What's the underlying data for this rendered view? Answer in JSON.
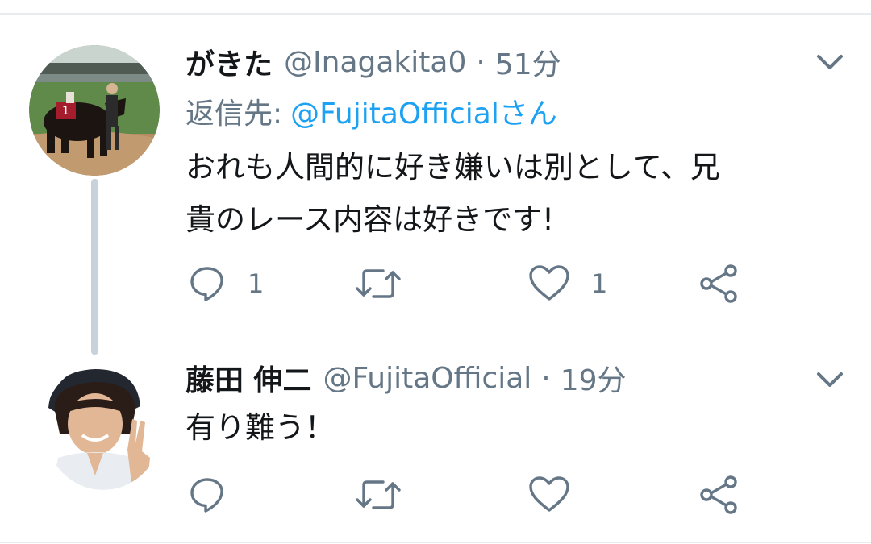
{
  "tweets": [
    {
      "display_name": "がきた",
      "handle": "@Inagakita0",
      "separator": "·",
      "time": "51分",
      "reply_to_prefix": "返信先:",
      "reply_to_target": "@FujitaOfficialさん",
      "text_lines": [
        "おれも人間的に好き嫌いは別として、兄",
        "貴のレース内容は好きです!"
      ],
      "reply_count": "1",
      "like_count": "1",
      "avatar_icon": "horse-photo-avatar"
    },
    {
      "display_name": "藤田 伸二",
      "handle": "@FujitaOfficial",
      "separator": "·",
      "time": "19分",
      "text_lines": [
        "有り難う！"
      ],
      "avatar_icon": "person-photo-avatar"
    }
  ],
  "icons": {
    "reply": "reply-icon",
    "retweet": "retweet-icon",
    "like": "heart-icon",
    "share": "share-icon",
    "more": "chevron-down-icon"
  },
  "colors": {
    "text": "#14171a",
    "secondary": "#657786",
    "link": "#1da1f2",
    "thread_line": "#c8d2da",
    "icon": "#657786"
  }
}
